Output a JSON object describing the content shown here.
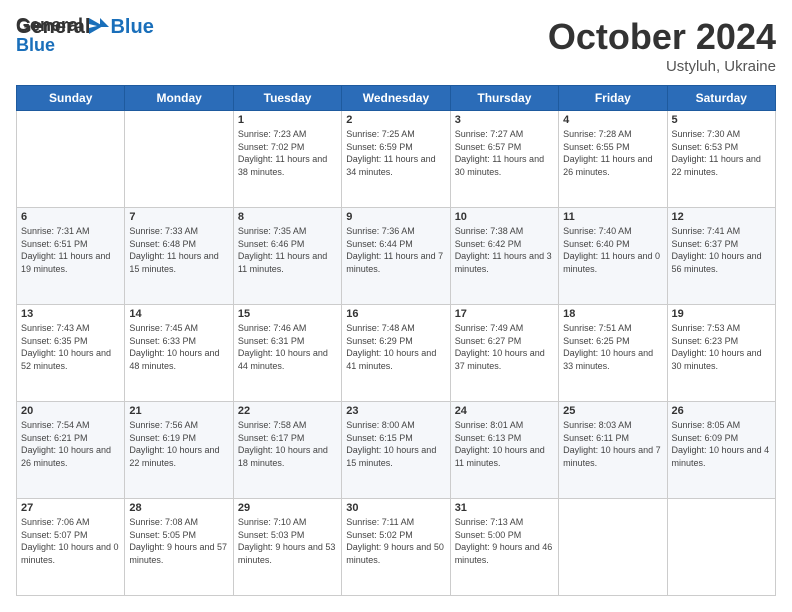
{
  "header": {
    "logo_line1": "General",
    "logo_line2": "Blue",
    "month_title": "October 2024",
    "location": "Ustyluh, Ukraine"
  },
  "weekdays": [
    "Sunday",
    "Monday",
    "Tuesday",
    "Wednesday",
    "Thursday",
    "Friday",
    "Saturday"
  ],
  "weeks": [
    [
      {
        "day": "",
        "content": ""
      },
      {
        "day": "",
        "content": ""
      },
      {
        "day": "1",
        "content": "Sunrise: 7:23 AM\nSunset: 7:02 PM\nDaylight: 11 hours and 38 minutes."
      },
      {
        "day": "2",
        "content": "Sunrise: 7:25 AM\nSunset: 6:59 PM\nDaylight: 11 hours and 34 minutes."
      },
      {
        "day": "3",
        "content": "Sunrise: 7:27 AM\nSunset: 6:57 PM\nDaylight: 11 hours and 30 minutes."
      },
      {
        "day": "4",
        "content": "Sunrise: 7:28 AM\nSunset: 6:55 PM\nDaylight: 11 hours and 26 minutes."
      },
      {
        "day": "5",
        "content": "Sunrise: 7:30 AM\nSunset: 6:53 PM\nDaylight: 11 hours and 22 minutes."
      }
    ],
    [
      {
        "day": "6",
        "content": "Sunrise: 7:31 AM\nSunset: 6:51 PM\nDaylight: 11 hours and 19 minutes."
      },
      {
        "day": "7",
        "content": "Sunrise: 7:33 AM\nSunset: 6:48 PM\nDaylight: 11 hours and 15 minutes."
      },
      {
        "day": "8",
        "content": "Sunrise: 7:35 AM\nSunset: 6:46 PM\nDaylight: 11 hours and 11 minutes."
      },
      {
        "day": "9",
        "content": "Sunrise: 7:36 AM\nSunset: 6:44 PM\nDaylight: 11 hours and 7 minutes."
      },
      {
        "day": "10",
        "content": "Sunrise: 7:38 AM\nSunset: 6:42 PM\nDaylight: 11 hours and 3 minutes."
      },
      {
        "day": "11",
        "content": "Sunrise: 7:40 AM\nSunset: 6:40 PM\nDaylight: 11 hours and 0 minutes."
      },
      {
        "day": "12",
        "content": "Sunrise: 7:41 AM\nSunset: 6:37 PM\nDaylight: 10 hours and 56 minutes."
      }
    ],
    [
      {
        "day": "13",
        "content": "Sunrise: 7:43 AM\nSunset: 6:35 PM\nDaylight: 10 hours and 52 minutes."
      },
      {
        "day": "14",
        "content": "Sunrise: 7:45 AM\nSunset: 6:33 PM\nDaylight: 10 hours and 48 minutes."
      },
      {
        "day": "15",
        "content": "Sunrise: 7:46 AM\nSunset: 6:31 PM\nDaylight: 10 hours and 44 minutes."
      },
      {
        "day": "16",
        "content": "Sunrise: 7:48 AM\nSunset: 6:29 PM\nDaylight: 10 hours and 41 minutes."
      },
      {
        "day": "17",
        "content": "Sunrise: 7:49 AM\nSunset: 6:27 PM\nDaylight: 10 hours and 37 minutes."
      },
      {
        "day": "18",
        "content": "Sunrise: 7:51 AM\nSunset: 6:25 PM\nDaylight: 10 hours and 33 minutes."
      },
      {
        "day": "19",
        "content": "Sunrise: 7:53 AM\nSunset: 6:23 PM\nDaylight: 10 hours and 30 minutes."
      }
    ],
    [
      {
        "day": "20",
        "content": "Sunrise: 7:54 AM\nSunset: 6:21 PM\nDaylight: 10 hours and 26 minutes."
      },
      {
        "day": "21",
        "content": "Sunrise: 7:56 AM\nSunset: 6:19 PM\nDaylight: 10 hours and 22 minutes."
      },
      {
        "day": "22",
        "content": "Sunrise: 7:58 AM\nSunset: 6:17 PM\nDaylight: 10 hours and 18 minutes."
      },
      {
        "day": "23",
        "content": "Sunrise: 8:00 AM\nSunset: 6:15 PM\nDaylight: 10 hours and 15 minutes."
      },
      {
        "day": "24",
        "content": "Sunrise: 8:01 AM\nSunset: 6:13 PM\nDaylight: 10 hours and 11 minutes."
      },
      {
        "day": "25",
        "content": "Sunrise: 8:03 AM\nSunset: 6:11 PM\nDaylight: 10 hours and 7 minutes."
      },
      {
        "day": "26",
        "content": "Sunrise: 8:05 AM\nSunset: 6:09 PM\nDaylight: 10 hours and 4 minutes."
      }
    ],
    [
      {
        "day": "27",
        "content": "Sunrise: 7:06 AM\nSunset: 5:07 PM\nDaylight: 10 hours and 0 minutes."
      },
      {
        "day": "28",
        "content": "Sunrise: 7:08 AM\nSunset: 5:05 PM\nDaylight: 9 hours and 57 minutes."
      },
      {
        "day": "29",
        "content": "Sunrise: 7:10 AM\nSunset: 5:03 PM\nDaylight: 9 hours and 53 minutes."
      },
      {
        "day": "30",
        "content": "Sunrise: 7:11 AM\nSunset: 5:02 PM\nDaylight: 9 hours and 50 minutes."
      },
      {
        "day": "31",
        "content": "Sunrise: 7:13 AM\nSunset: 5:00 PM\nDaylight: 9 hours and 46 minutes."
      },
      {
        "day": "",
        "content": ""
      },
      {
        "day": "",
        "content": ""
      }
    ]
  ]
}
